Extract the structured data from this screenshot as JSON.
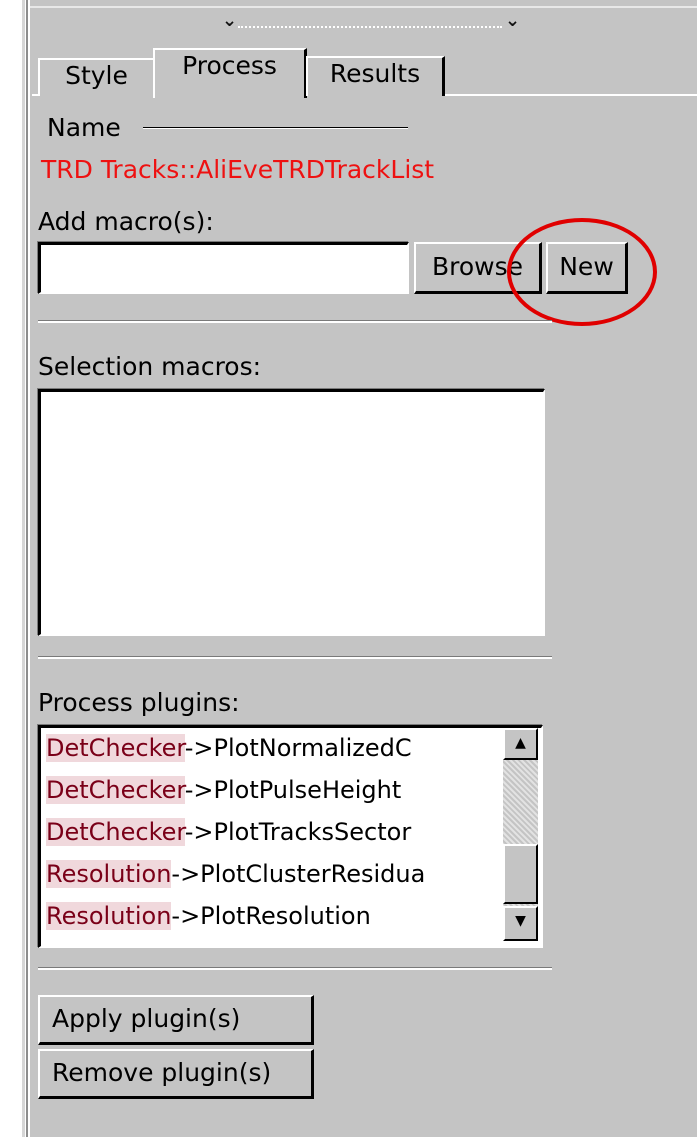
{
  "tabs": [
    {
      "label": "Style"
    },
    {
      "label": "Process"
    },
    {
      "label": "Results"
    }
  ],
  "name_section": {
    "label": "Name",
    "value": "TRD Tracks::AliEveTRDTrackList"
  },
  "add_macro": {
    "label": "Add macro(s):",
    "input_value": "",
    "browse_label": "Browse",
    "new_label": "New"
  },
  "selection_macros": {
    "label": "Selection macros:",
    "items": []
  },
  "process_plugins": {
    "label": "Process plugins:",
    "items": [
      {
        "prefix": "DetChecker",
        "suffix": "->PlotNormalizedC"
      },
      {
        "prefix": "DetChecker",
        "suffix": "->PlotPulseHeight"
      },
      {
        "prefix": "DetChecker",
        "suffix": "->PlotTracksSector"
      },
      {
        "prefix": "Resolution",
        "suffix": "->PlotClusterResidua"
      },
      {
        "prefix": "Resolution",
        "suffix": "->PlotResolution"
      }
    ]
  },
  "actions": {
    "apply_label": "Apply plugin(s)",
    "remove_label": "Remove plugin(s)"
  },
  "annotation": {
    "color": "#e00000",
    "icon": "red-circle-highlight"
  },
  "colors": {
    "panel_bg": "#c4c4c4",
    "name_text": "#ee1111",
    "plugin_prefix": "#7a0018"
  }
}
